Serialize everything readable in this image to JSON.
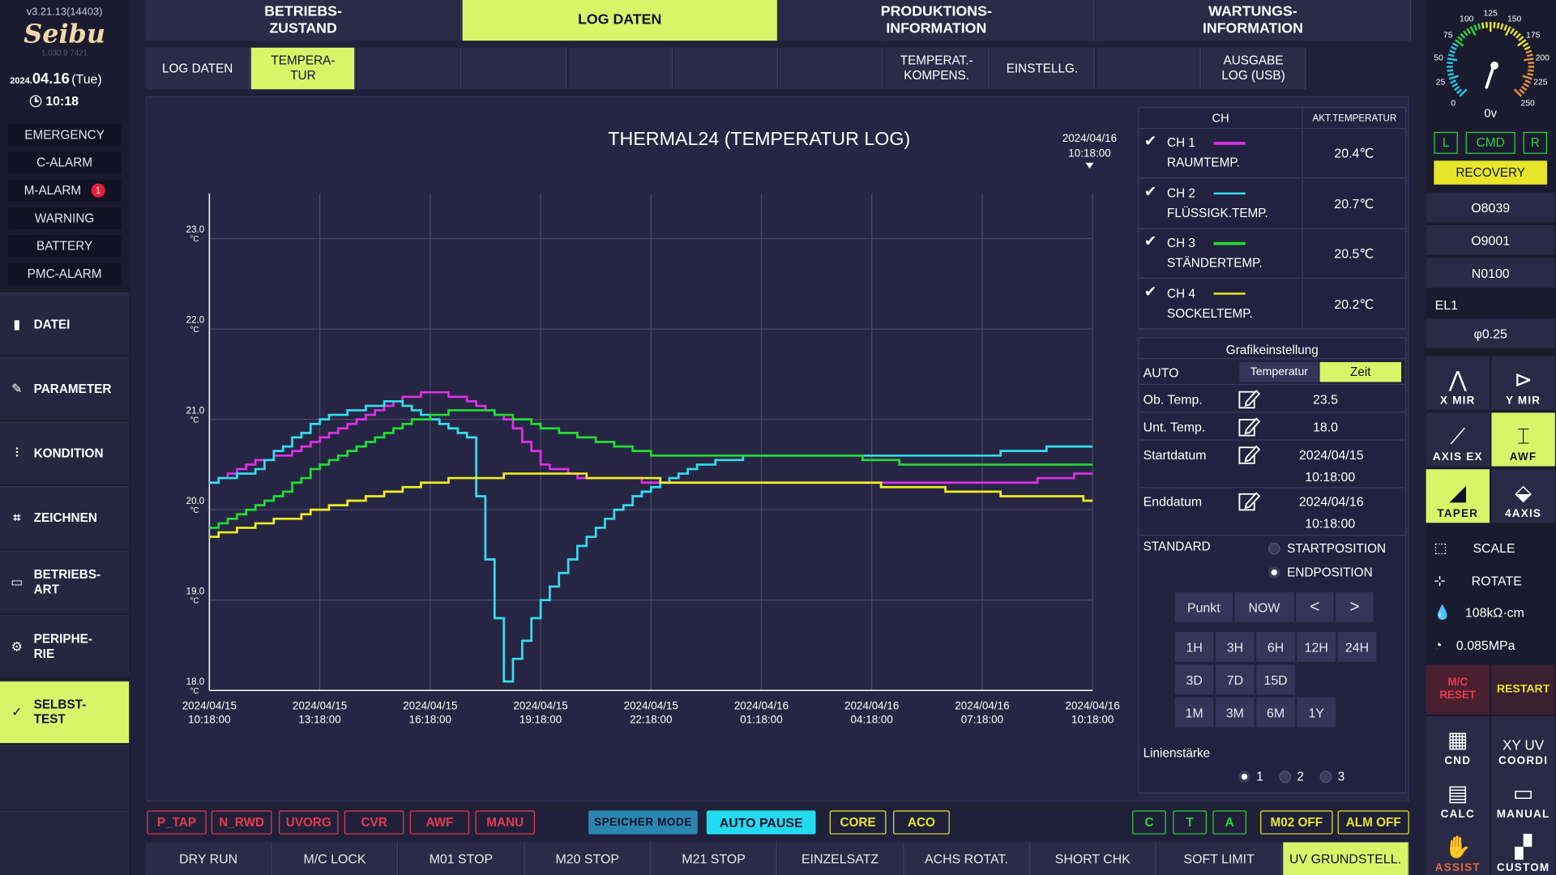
{
  "header": {
    "version": "v3.21.13(14403)",
    "logo": "Seibu",
    "logo_sub": "1,030.9     7421",
    "date_prefix": "2024.",
    "date_main": "04.16",
    "date_day": "(Tue)",
    "time": "10:18"
  },
  "alarms": [
    {
      "label": "EMERGENCY"
    },
    {
      "label": "C-ALARM"
    },
    {
      "label": "M-ALARM",
      "badge": "1"
    },
    {
      "label": "WARNING"
    },
    {
      "label": "BATTERY"
    },
    {
      "label": "PMC-ALARM"
    }
  ],
  "nav": [
    {
      "label": "DATEI",
      "icon": "file-icon"
    },
    {
      "label": "PARAMETER",
      "icon": "wrench-icon"
    },
    {
      "label": "KONDITION",
      "icon": "sliders-icon"
    },
    {
      "label": "ZEICHNEN",
      "icon": "drawing-icon"
    },
    {
      "label": "BETRIEBS-\nART",
      "icon": "mode-icon"
    },
    {
      "label": "PERIPHE-\nRIE",
      "icon": "gear-icon"
    },
    {
      "label": "SELBST-\nTEST",
      "icon": "check-icon",
      "active": true
    }
  ],
  "top_tabs": [
    {
      "label": "BETRIEBS-\nZUSTAND"
    },
    {
      "label": "LOG DATEN",
      "active": true
    },
    {
      "label": "PRODUKTIONS-\nINFORMATION"
    },
    {
      "label": "WARTUNGS-\nINFORMATION"
    }
  ],
  "sub_tabs": [
    {
      "label": "LOG DATEN"
    },
    {
      "label": "TEMPERA-\nTUR",
      "active": true
    },
    {
      "label": ""
    },
    {
      "label": ""
    },
    {
      "label": ""
    },
    {
      "label": ""
    },
    {
      "label": ""
    },
    {
      "label": "TEMPERAT.-\nKOMPENS."
    },
    {
      "label": "EINSTELLG."
    },
    {
      "label": ""
    },
    {
      "label": "AUSGABE\nLOG (USB)"
    }
  ],
  "chart_data": {
    "type": "line",
    "title": "THERMAL24 (TEMPERATUR LOG)",
    "cursor_label": "2024/04/16\n10:18:00",
    "ylim": [
      18.0,
      23.5
    ],
    "y_ticks": [
      "23.0",
      "22.0",
      "21.0",
      "20.0",
      "19.0",
      "18.0"
    ],
    "y_unit": "°C",
    "x_ticks": [
      "2024/04/15\n10:18:00",
      "2024/04/15\n13:18:00",
      "2024/04/15\n16:18:00",
      "2024/04/15\n19:18:00",
      "2024/04/15\n22:18:00",
      "2024/04/16\n01:18:00",
      "2024/04/16\n04:18:00",
      "2024/04/16\n07:18:00",
      "2024/04/16\n10:18:00"
    ],
    "x_hours": [
      0,
      1,
      2,
      3,
      4,
      5,
      6,
      7,
      8,
      9,
      10,
      11,
      12,
      13,
      14,
      15,
      16,
      17,
      18,
      19,
      20,
      21,
      22,
      23,
      24
    ],
    "series": [
      {
        "name": "CH 1",
        "color": "#e030e8",
        "values": [
          20.3,
          20.5,
          20.6,
          20.8,
          21.0,
          21.2,
          21.3,
          21.2,
          21.0,
          20.5,
          20.35,
          20.35,
          20.3,
          20.3,
          20.3,
          20.3,
          20.3,
          20.3,
          20.3,
          20.3,
          20.3,
          20.3,
          20.3,
          20.35,
          20.4
        ]
      },
      {
        "name": "CH 2",
        "color": "#33ddee",
        "values": [
          20.3,
          20.4,
          20.7,
          21.0,
          21.1,
          21.2,
          21.0,
          20.8,
          18.1,
          19.0,
          19.6,
          20.0,
          20.25,
          20.45,
          20.55,
          20.6,
          20.6,
          20.6,
          20.6,
          20.6,
          20.6,
          20.6,
          20.65,
          20.7,
          20.7
        ]
      },
      {
        "name": "CH 3",
        "color": "#22dd33",
        "values": [
          19.8,
          20.0,
          20.2,
          20.5,
          20.7,
          20.9,
          21.05,
          21.1,
          21.05,
          20.9,
          20.8,
          20.7,
          20.62,
          20.6,
          20.6,
          20.6,
          20.6,
          20.6,
          20.55,
          20.5,
          20.5,
          20.5,
          20.5,
          20.5,
          20.5
        ]
      },
      {
        "name": "CH 4",
        "color": "#eeee22",
        "values": [
          19.7,
          19.8,
          19.9,
          20.0,
          20.1,
          20.2,
          20.3,
          20.35,
          20.38,
          20.38,
          20.38,
          20.35,
          20.33,
          20.3,
          20.3,
          20.3,
          20.3,
          20.3,
          20.28,
          20.25,
          20.22,
          20.2,
          20.15,
          20.15,
          20.1
        ]
      }
    ]
  },
  "channels": {
    "head_ch": "CH",
    "head_temp": "AKT.TEMPERATUR",
    "rows": [
      {
        "ch": "CH 1",
        "name": "RAUMTEMP.",
        "temp": "20.4℃",
        "color": "#e030e8"
      },
      {
        "ch": "CH 2",
        "name": "FLÜSSIGK.TEMP.",
        "temp": "20.7℃",
        "color": "#33ddee"
      },
      {
        "ch": "CH 3",
        "name": "STÄNDERTEMP.",
        "temp": "20.5℃",
        "color": "#22dd33"
      },
      {
        "ch": "CH 4",
        "name": "SOCKELTEMP.",
        "temp": "20.2℃",
        "color": "#eeee22"
      }
    ]
  },
  "settings": {
    "title": "Grafikeinstellung",
    "auto": "AUTO",
    "opt_temp": "Temperatur",
    "opt_zeit": "Zeit",
    "ob_label": "Ob. Temp.",
    "ob_value": "23.5",
    "unt_label": "Unt. Temp.",
    "unt_value": "18.0",
    "start_label": "Startdatum",
    "start_date": "2024/04/15",
    "start_time": "10:18:00",
    "end_label": "Enddatum",
    "end_date": "2024/04/16",
    "end_time": "10:18:00",
    "standard": "STANDARD",
    "startpos": "STARTPOSITION",
    "endpos": "ENDPOSITION",
    "punkt": "Punkt",
    "now": "NOW",
    "prev": "<",
    "next": ">",
    "ranges1": [
      "1H",
      "3H",
      "6H",
      "12H",
      "24H"
    ],
    "ranges2": [
      "3D",
      "7D",
      "15D"
    ],
    "ranges3": [
      "1M",
      "3M",
      "6M",
      "1Y"
    ],
    "linienstaerke": "Linienstärke",
    "line_opts": [
      "1",
      "2",
      "3"
    ]
  },
  "status_tags": [
    {
      "label": "P_TAP",
      "color": "#e83a50"
    },
    {
      "label": "N_RWD",
      "color": "#e83a50"
    },
    {
      "label": "UVORG",
      "color": "#e83a50"
    },
    {
      "label": "CVR",
      "color": "#e83a50"
    },
    {
      "label": "AWF",
      "color": "#e83a50"
    },
    {
      "label": "MANU",
      "color": "#e83a50"
    }
  ],
  "mode_tags": {
    "speicher": "SPEICHER MODE",
    "autopause": "AUTO PAUSE",
    "core": "CORE",
    "aco": "ACO",
    "c": "C",
    "t": "T",
    "a": "A",
    "m02": "M02 OFF",
    "alm": "ALM OFF"
  },
  "bottom_buttons": [
    {
      "label": "DRY RUN"
    },
    {
      "label": "M/C LOCK"
    },
    {
      "label": "M01 STOP"
    },
    {
      "label": "M20 STOP"
    },
    {
      "label": "M21 STOP"
    },
    {
      "label": "EINZELSATZ"
    },
    {
      "label": "ACHS ROTAT."
    },
    {
      "label": "SHORT CHK"
    },
    {
      "label": "SOFT LIMIT"
    },
    {
      "label": "UV GRUNDSTELL.",
      "active": true
    }
  ],
  "gauge": {
    "ticks": [
      "0",
      "25",
      "50",
      "75",
      "100",
      "125",
      "150",
      "175",
      "200",
      "225",
      "250"
    ],
    "reading": "0v"
  },
  "right": {
    "l": "L",
    "cmd": "CMD",
    "r": "R",
    "recovery": "RECOVERY",
    "o1": "O8039",
    "o2": "O9001",
    "n": "N0100",
    "el": "EL1",
    "phi": "φ0.25",
    "icons": [
      {
        "label": "X MIR"
      },
      {
        "label": "Y MIR"
      },
      {
        "label": "AXIS EX"
      },
      {
        "label": "AWF",
        "active": true
      },
      {
        "label": "TAPER",
        "active": true
      },
      {
        "label": "4AXIS"
      }
    ],
    "scale": "SCALE",
    "rotate": "ROTATE",
    "resist": "108kΩ·cm",
    "press": "0.085MPa",
    "mc_reset": "M/C\nRESET",
    "restart": "RESTART",
    "cnd": "CND",
    "coordi": "COORDI",
    "calc": "CALC",
    "manual": "MANUAL",
    "assist": "ASSIST",
    "custom": "CUSTOM"
  }
}
